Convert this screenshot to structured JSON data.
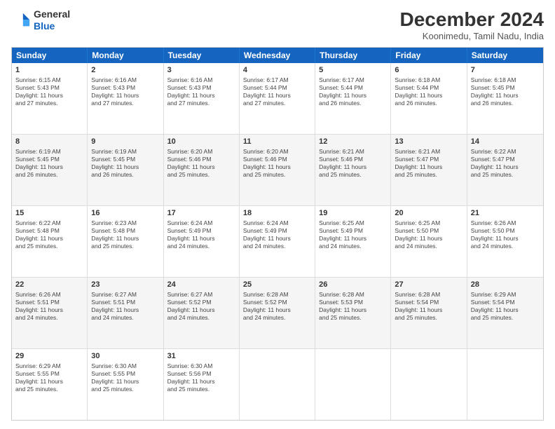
{
  "logo": {
    "line1": "General",
    "line2": "Blue"
  },
  "title": "December 2024",
  "location": "Koonimedu, Tamil Nadu, India",
  "days": [
    "Sunday",
    "Monday",
    "Tuesday",
    "Wednesday",
    "Thursday",
    "Friday",
    "Saturday"
  ],
  "rows": [
    [
      {
        "day": "1",
        "info": "Sunrise: 6:15 AM\nSunset: 5:43 PM\nDaylight: 11 hours\nand 27 minutes."
      },
      {
        "day": "2",
        "info": "Sunrise: 6:16 AM\nSunset: 5:43 PM\nDaylight: 11 hours\nand 27 minutes."
      },
      {
        "day": "3",
        "info": "Sunrise: 6:16 AM\nSunset: 5:43 PM\nDaylight: 11 hours\nand 27 minutes."
      },
      {
        "day": "4",
        "info": "Sunrise: 6:17 AM\nSunset: 5:44 PM\nDaylight: 11 hours\nand 27 minutes."
      },
      {
        "day": "5",
        "info": "Sunrise: 6:17 AM\nSunset: 5:44 PM\nDaylight: 11 hours\nand 26 minutes."
      },
      {
        "day": "6",
        "info": "Sunrise: 6:18 AM\nSunset: 5:44 PM\nDaylight: 11 hours\nand 26 minutes."
      },
      {
        "day": "7",
        "info": "Sunrise: 6:18 AM\nSunset: 5:45 PM\nDaylight: 11 hours\nand 26 minutes."
      }
    ],
    [
      {
        "day": "8",
        "info": "Sunrise: 6:19 AM\nSunset: 5:45 PM\nDaylight: 11 hours\nand 26 minutes."
      },
      {
        "day": "9",
        "info": "Sunrise: 6:19 AM\nSunset: 5:45 PM\nDaylight: 11 hours\nand 26 minutes."
      },
      {
        "day": "10",
        "info": "Sunrise: 6:20 AM\nSunset: 5:46 PM\nDaylight: 11 hours\nand 25 minutes."
      },
      {
        "day": "11",
        "info": "Sunrise: 6:20 AM\nSunset: 5:46 PM\nDaylight: 11 hours\nand 25 minutes."
      },
      {
        "day": "12",
        "info": "Sunrise: 6:21 AM\nSunset: 5:46 PM\nDaylight: 11 hours\nand 25 minutes."
      },
      {
        "day": "13",
        "info": "Sunrise: 6:21 AM\nSunset: 5:47 PM\nDaylight: 11 hours\nand 25 minutes."
      },
      {
        "day": "14",
        "info": "Sunrise: 6:22 AM\nSunset: 5:47 PM\nDaylight: 11 hours\nand 25 minutes."
      }
    ],
    [
      {
        "day": "15",
        "info": "Sunrise: 6:22 AM\nSunset: 5:48 PM\nDaylight: 11 hours\nand 25 minutes."
      },
      {
        "day": "16",
        "info": "Sunrise: 6:23 AM\nSunset: 5:48 PM\nDaylight: 11 hours\nand 25 minutes."
      },
      {
        "day": "17",
        "info": "Sunrise: 6:24 AM\nSunset: 5:49 PM\nDaylight: 11 hours\nand 24 minutes."
      },
      {
        "day": "18",
        "info": "Sunrise: 6:24 AM\nSunset: 5:49 PM\nDaylight: 11 hours\nand 24 minutes."
      },
      {
        "day": "19",
        "info": "Sunrise: 6:25 AM\nSunset: 5:49 PM\nDaylight: 11 hours\nand 24 minutes."
      },
      {
        "day": "20",
        "info": "Sunrise: 6:25 AM\nSunset: 5:50 PM\nDaylight: 11 hours\nand 24 minutes."
      },
      {
        "day": "21",
        "info": "Sunrise: 6:26 AM\nSunset: 5:50 PM\nDaylight: 11 hours\nand 24 minutes."
      }
    ],
    [
      {
        "day": "22",
        "info": "Sunrise: 6:26 AM\nSunset: 5:51 PM\nDaylight: 11 hours\nand 24 minutes."
      },
      {
        "day": "23",
        "info": "Sunrise: 6:27 AM\nSunset: 5:51 PM\nDaylight: 11 hours\nand 24 minutes."
      },
      {
        "day": "24",
        "info": "Sunrise: 6:27 AM\nSunset: 5:52 PM\nDaylight: 11 hours\nand 24 minutes."
      },
      {
        "day": "25",
        "info": "Sunrise: 6:28 AM\nSunset: 5:52 PM\nDaylight: 11 hours\nand 24 minutes."
      },
      {
        "day": "26",
        "info": "Sunrise: 6:28 AM\nSunset: 5:53 PM\nDaylight: 11 hours\nand 25 minutes."
      },
      {
        "day": "27",
        "info": "Sunrise: 6:28 AM\nSunset: 5:54 PM\nDaylight: 11 hours\nand 25 minutes."
      },
      {
        "day": "28",
        "info": "Sunrise: 6:29 AM\nSunset: 5:54 PM\nDaylight: 11 hours\nand 25 minutes."
      }
    ],
    [
      {
        "day": "29",
        "info": "Sunrise: 6:29 AM\nSunset: 5:55 PM\nDaylight: 11 hours\nand 25 minutes."
      },
      {
        "day": "30",
        "info": "Sunrise: 6:30 AM\nSunset: 5:55 PM\nDaylight: 11 hours\nand 25 minutes."
      },
      {
        "day": "31",
        "info": "Sunrise: 6:30 AM\nSunset: 5:56 PM\nDaylight: 11 hours\nand 25 minutes."
      },
      {
        "day": "",
        "info": ""
      },
      {
        "day": "",
        "info": ""
      },
      {
        "day": "",
        "info": ""
      },
      {
        "day": "",
        "info": ""
      }
    ]
  ]
}
